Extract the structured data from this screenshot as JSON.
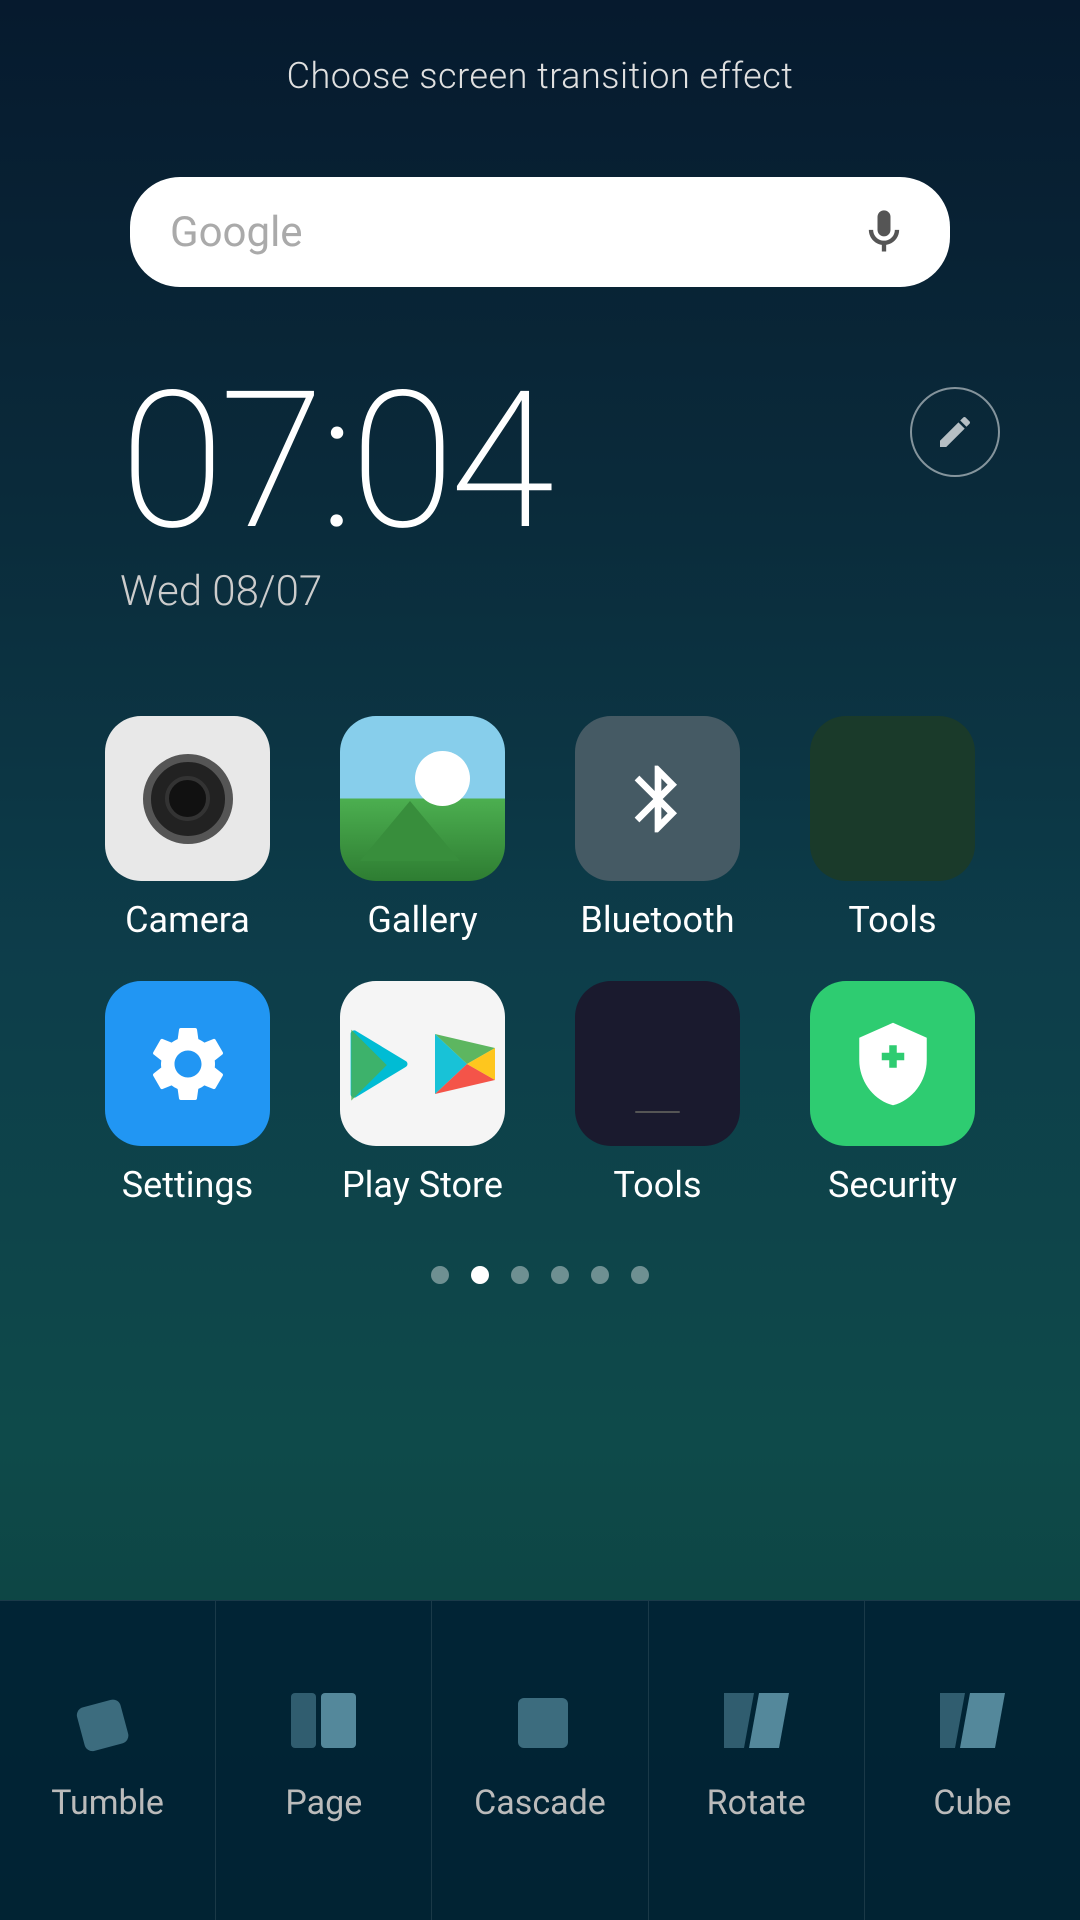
{
  "header": {
    "title": "Choose screen transition effect"
  },
  "search": {
    "placeholder": "Google",
    "mic_label": "microphone"
  },
  "clock": {
    "time": "07:04",
    "date": "Wed 08/07"
  },
  "apps": [
    {
      "id": "camera",
      "label": "Camera",
      "row": 1
    },
    {
      "id": "gallery",
      "label": "Gallery",
      "row": 1
    },
    {
      "id": "bluetooth",
      "label": "Bluetooth",
      "row": 1
    },
    {
      "id": "tools-folder",
      "label": "Tools",
      "row": 1
    },
    {
      "id": "settings",
      "label": "Settings",
      "row": 2
    },
    {
      "id": "playstore",
      "label": "Play Store",
      "row": 2
    },
    {
      "id": "tools-apps",
      "label": "Tools",
      "row": 2
    },
    {
      "id": "security",
      "label": "Security",
      "row": 2
    }
  ],
  "page_dots": {
    "total": 6,
    "active": 1
  },
  "transitions": [
    {
      "id": "tumble",
      "label": "Tumble"
    },
    {
      "id": "page",
      "label": "Page"
    },
    {
      "id": "cascade",
      "label": "Cascade"
    },
    {
      "id": "rotate",
      "label": "Rotate"
    },
    {
      "id": "cube",
      "label": "Cube"
    }
  ]
}
